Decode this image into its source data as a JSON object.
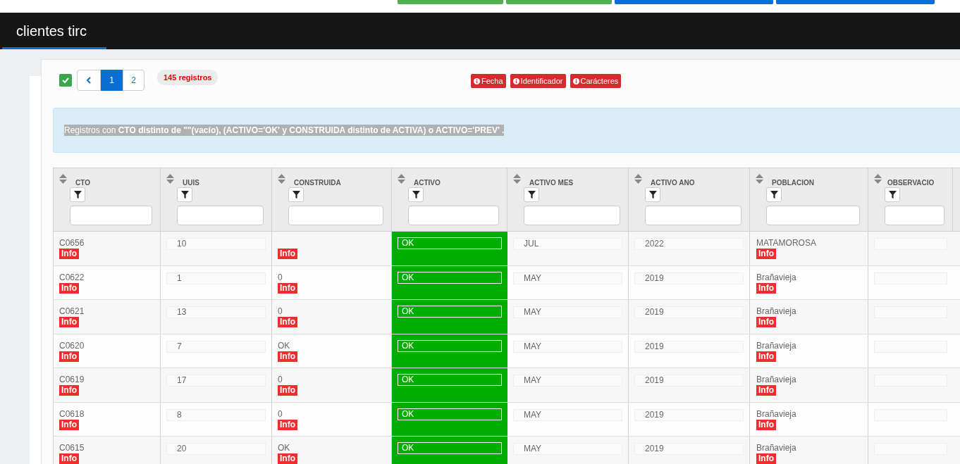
{
  "top_buttons": [
    {
      "color": "#4caf50"
    },
    {
      "color": "#4caf50"
    },
    {
      "color": "#0b6fd1"
    },
    {
      "color": "#0b6fd1"
    }
  ],
  "header": {
    "title": "clientes tirc"
  },
  "toolbar": {
    "select_all": {
      "checked": true
    },
    "pages": [
      {
        "label": "1",
        "selected": true
      },
      {
        "label": "2",
        "selected": false
      }
    ],
    "count": "145 registros",
    "filters": [
      "Fecha",
      "Identificador",
      "Carácteres"
    ]
  },
  "notice": "Registros con **CTO distinto de \"\"(vacío), (ACTIVO='OK' y CONSTRUIDA distinto de ACTIVA) o ACTIVO='PREV' .**",
  "table": {
    "columns": [
      "CTO",
      "UUIS",
      "CONSTRUIDA",
      "ACTIVO",
      "ACTIVO MES",
      "ACTIVO ANO",
      "POBLACION",
      "OBSERVACIO"
    ],
    "rows": [
      {
        "cto": "C0656",
        "cto_badge": "Info",
        "uuis": "10",
        "construida": "",
        "construida_badge": "Info",
        "activo": {
          "value": "OK",
          "color": "#00ad00"
        },
        "activo_mes": "JUL",
        "activo_ano": "2022",
        "poblacion": "MATAMOROSA",
        "poblacion_badge": "Info"
      },
      {
        "cto": "C0622",
        "cto_badge": "Info",
        "uuis": "1",
        "construida": "0",
        "construida_badge": "Info",
        "activo": {
          "value": "OK",
          "color": "#00ad00"
        },
        "activo_mes": "MAY",
        "activo_ano": "2019",
        "poblacion": "Brañavieja",
        "poblacion_badge": "Info"
      },
      {
        "cto": "C0621",
        "cto_badge": "Info",
        "uuis": "13",
        "construida": "0",
        "construida_badge": "Info",
        "activo": {
          "value": "OK",
          "color": "#00ad00"
        },
        "activo_mes": "MAY",
        "activo_ano": "2019",
        "poblacion": "Brañavieja",
        "poblacion_badge": "Info"
      },
      {
        "cto": "C0620",
        "cto_badge": "Info",
        "uuis": "7",
        "construida": "OK",
        "construida_badge": "Info",
        "activo": {
          "value": "OK",
          "color": "#00ad00"
        },
        "activo_mes": "MAY",
        "activo_ano": "2019",
        "poblacion": "Brañavieja",
        "poblacion_badge": "Info"
      },
      {
        "cto": "C0619",
        "cto_badge": "Info",
        "uuis": "17",
        "construida": "0",
        "construida_badge": "Info",
        "activo": {
          "value": "OK",
          "color": "#00ad00"
        },
        "activo_mes": "MAY",
        "activo_ano": "2019",
        "poblacion": "Brañavieja",
        "poblacion_badge": "Info"
      },
      {
        "cto": "C0618",
        "cto_badge": "Info",
        "uuis": "8",
        "construida": "0",
        "construida_badge": "Info",
        "activo": {
          "value": "OK",
          "color": "#00ad00"
        },
        "activo_mes": "MAY",
        "activo_ano": "2019",
        "poblacion": "Brañavieja",
        "poblacion_badge": "Info"
      },
      {
        "cto": "C0615",
        "cto_badge": "Info",
        "uuis": "20",
        "construida": "OK",
        "construida_badge": "Info",
        "activo": {
          "value": "OK",
          "color": "#00ad00"
        },
        "activo_mes": "MAY",
        "activo_ano": "2019",
        "poblacion": "Brañavieja",
        "poblacion_badge": "Info"
      }
    ]
  }
}
